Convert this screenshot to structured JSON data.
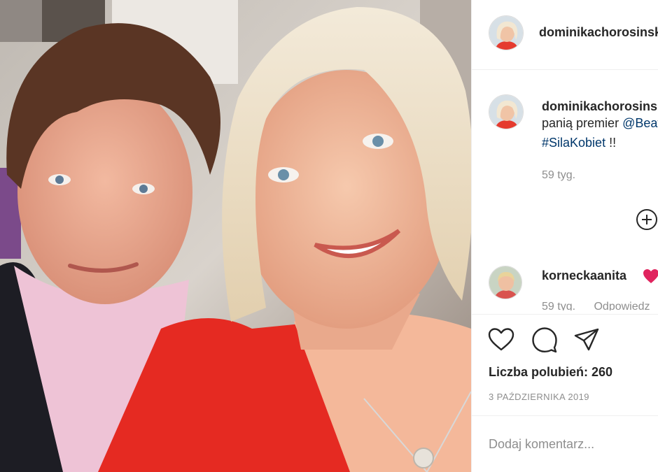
{
  "post": {
    "photo_icon": "selfie-photo",
    "author": {
      "username": "dominikachorosinska",
      "avatar_icon": "blonde-woman-avatar"
    },
    "caption": {
      "username": "dominikachorosinska",
      "line1_text": "panią premier",
      "line1_mention": "@Beata",
      "line2_tag": "#SilaKobiet",
      "line2_suffix": " !!",
      "time": "59 tyg."
    },
    "load_more_icon": "plus-circle-icon",
    "comments": [
      {
        "username": "korneckaanita",
        "emoji_icon": "red-heart-icon",
        "time": "59 tyg.",
        "reply_label": "Odpowiedz"
      }
    ],
    "likes_text": "Liczba polubień: 260",
    "date": "3 października 2019",
    "comment_placeholder": "Dodaj komentarz..."
  },
  "colors": {
    "link": "#00376b",
    "muted": "#8e8e8e",
    "text": "#262626",
    "heart": "#ed4956"
  }
}
